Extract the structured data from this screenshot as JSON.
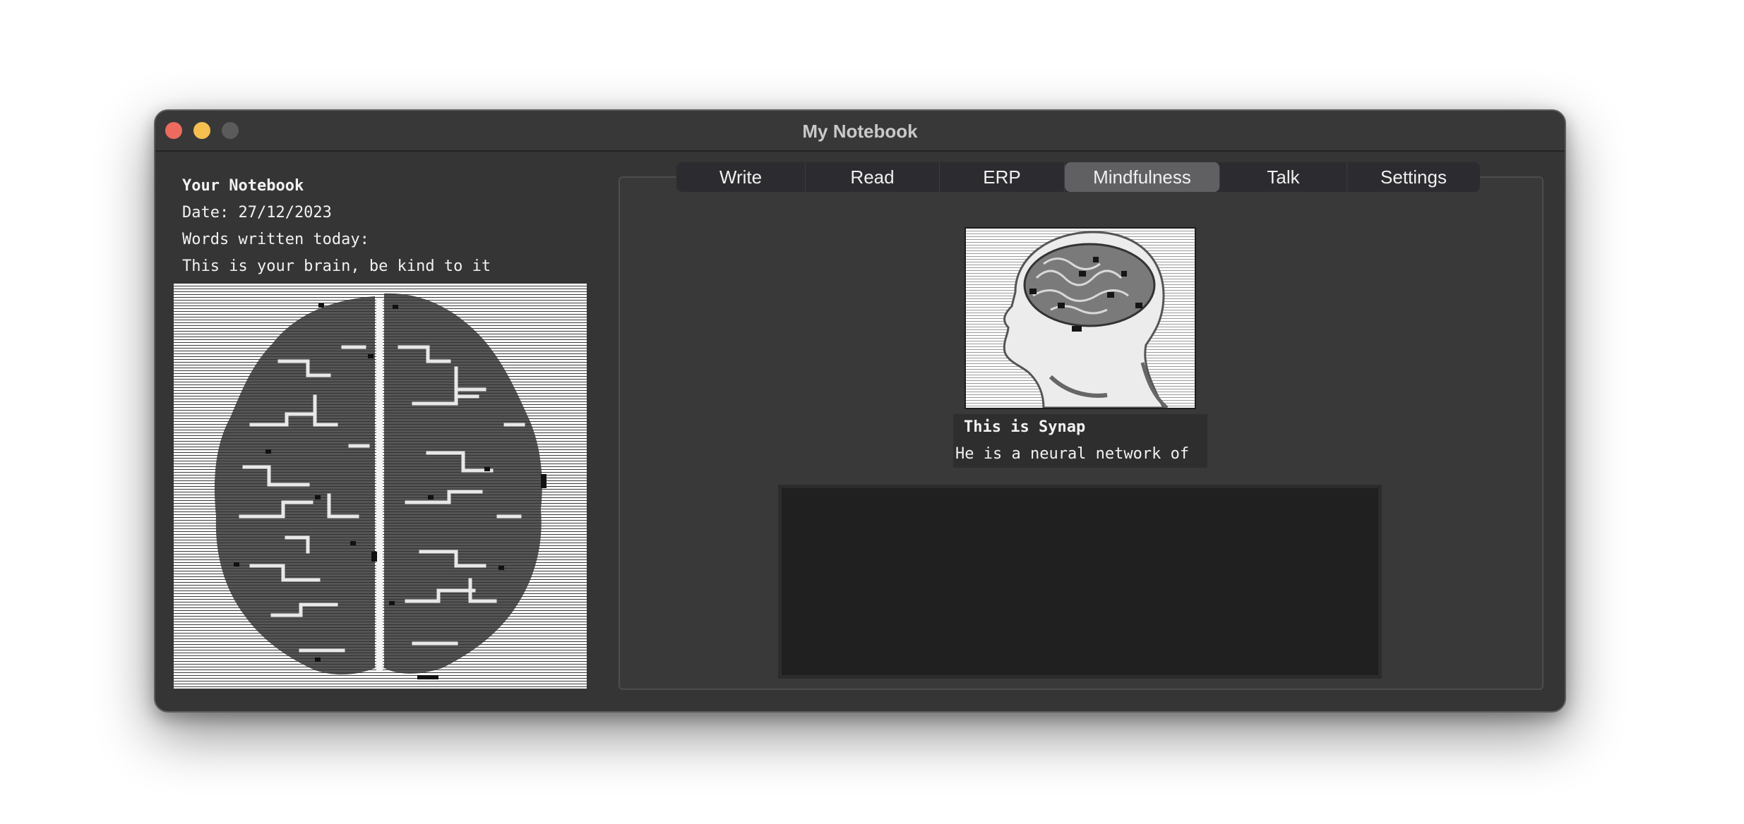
{
  "window": {
    "title": "My Notebook"
  },
  "notebook": {
    "heading": "Your Notebook",
    "date_line": "Date: 27/12/2023",
    "words_line": "Words written today:",
    "brain_message": "This is your brain, be kind to it"
  },
  "tabs": [
    {
      "label": "Write",
      "active": false
    },
    {
      "label": "Read",
      "active": false
    },
    {
      "label": "ERP",
      "active": false
    },
    {
      "label": "Mindfulness",
      "active": true
    },
    {
      "label": "Talk",
      "active": false
    },
    {
      "label": "Settings",
      "active": false
    }
  ],
  "synap": {
    "title": "This is Synap",
    "description": "He is a neural network of"
  },
  "input": {
    "value": ""
  },
  "colors": {
    "window_bg": "#353535",
    "close": "#ed6a5e",
    "minimize": "#f5bf4f",
    "zoom_disabled": "#5b5b5b",
    "active_tab": "#606063"
  },
  "images": {
    "left": "brain-illustration",
    "right": "synap-head-illustration"
  }
}
